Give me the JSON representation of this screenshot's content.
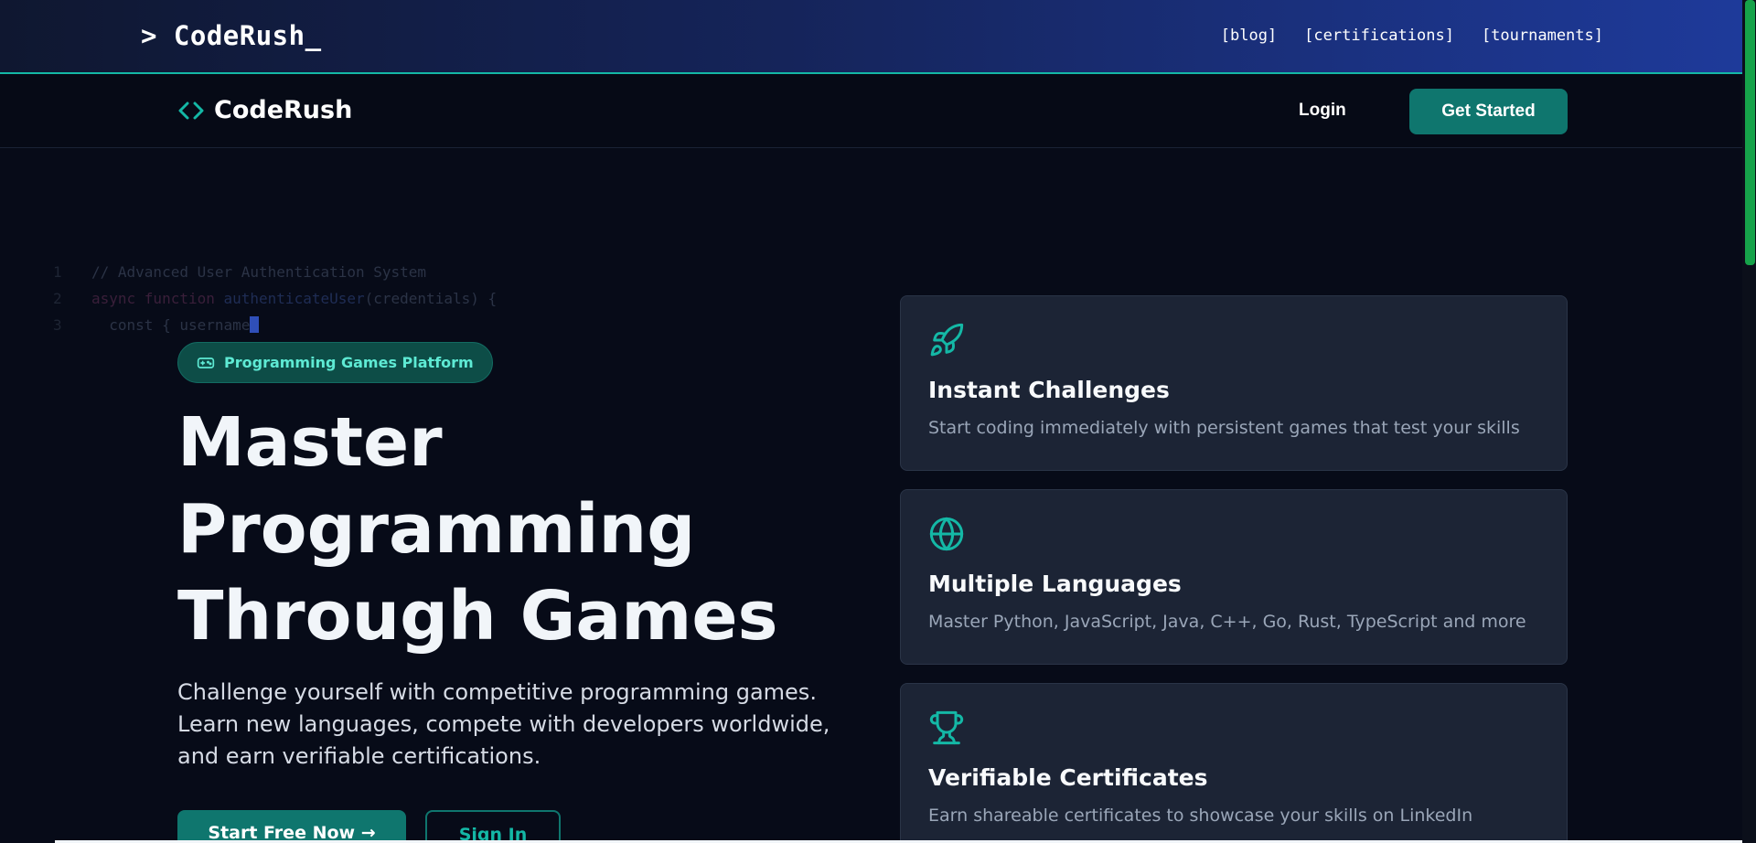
{
  "topbar": {
    "brand": "> CodeRush_",
    "links": [
      "[blog]",
      "[certifications]",
      "[tournaments]"
    ]
  },
  "navbar": {
    "logo_text": "CodeRush",
    "login_label": "Login",
    "get_started_label": "Get Started"
  },
  "code_lines": [
    {
      "num": "1",
      "text": "// Advanced User Authentication System"
    },
    {
      "num": "2",
      "kw": "async function ",
      "fn": "authenticateUser",
      "rest": "(credentials) {"
    },
    {
      "num": "3",
      "text": "  const { username"
    }
  ],
  "hero": {
    "badge": "Programming Games Platform",
    "headline": [
      "Master",
      "Programming",
      "Through Games"
    ],
    "subtext": [
      "Challenge yourself with competitive programming games.",
      "Learn new languages, compete with developers worldwide,",
      "and earn verifiable certifications."
    ],
    "primary_button": "Start Free Now →",
    "secondary_button": "Sign In"
  },
  "features": [
    {
      "icon": "rocket-icon",
      "title": "Instant Challenges",
      "desc": "Start coding immediately with persistent games that test your skills"
    },
    {
      "icon": "globe-icon",
      "title": "Multiple Languages",
      "desc": "Master Python, JavaScript, Java, C++, Go, Rust, TypeScript and more"
    },
    {
      "icon": "trophy-icon",
      "title": "Verifiable Certificates",
      "desc": "Earn shareable certificates to showcase your skills on LinkedIn"
    }
  ],
  "colors": {
    "accent": "#14b8a6",
    "button": "#0f766e",
    "background": "#070b18",
    "card": "#1c2435"
  }
}
